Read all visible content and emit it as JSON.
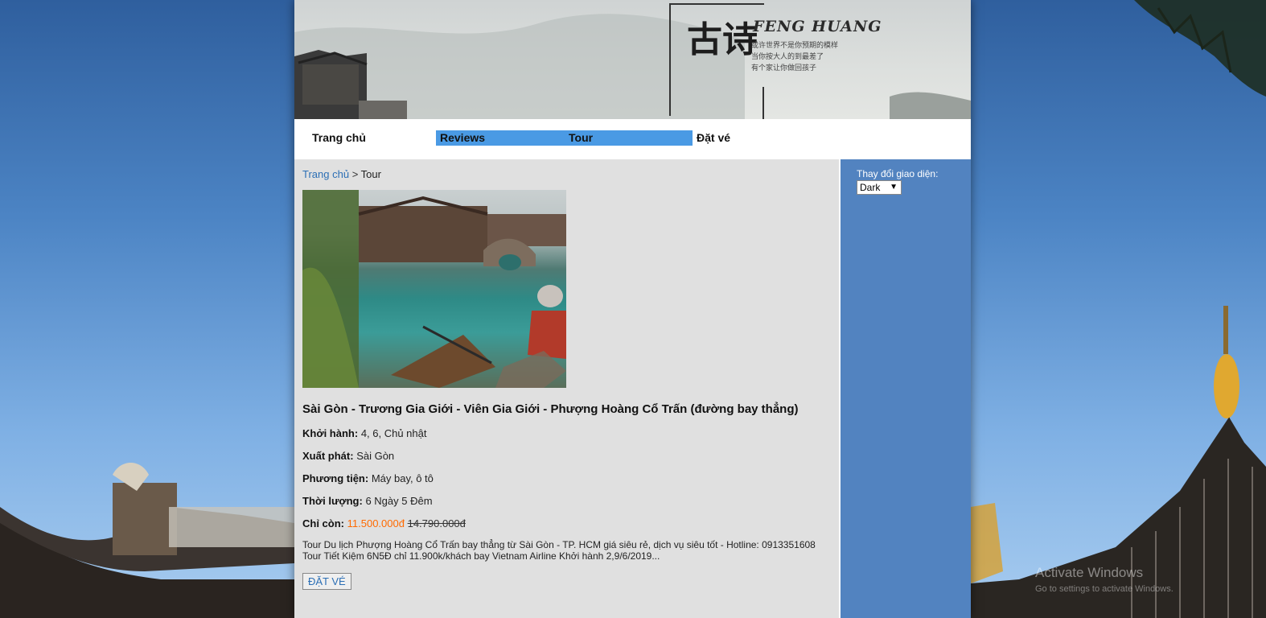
{
  "nav": {
    "home": "Trang chủ",
    "reviews": "Reviews",
    "tour": "Tour",
    "book": "Đặt vé"
  },
  "banner": {
    "title": "FENG HUANG",
    "cn_line1": "或许世界不是你预期的模样",
    "cn_line2": "当你按大人的到最差了",
    "cn_line3": "有个家让你做回孩子",
    "cn_big": "古诗"
  },
  "breadcrumb": {
    "home": "Trang chủ",
    "separator": ">",
    "current": "Tour"
  },
  "tour": {
    "title": "Sài Gòn - Trương Gia Giới - Viên Gia Giới - Phượng Hoàng Cổ Trấn (đường bay thẳng)",
    "depart_days_label": "Khởi hành:",
    "depart_days": "4, 6, Chủ nhật",
    "origin_label": "Xuất phát:",
    "origin": "Sài Gòn",
    "transport_label": "Phương tiện:",
    "transport": "Máy bay, ô tô",
    "duration_label": "Thời lượng:",
    "duration": "6 Ngày 5 Đêm",
    "price_label": "Chỉ còn:",
    "price_now": "11.500.000đ",
    "price_old": "14.790.000đ",
    "description": "Tour Du lịch Phượng Hoàng Cổ Trấn bay thẳng từ Sài Gòn - TP. HCM giá siêu rẻ, dịch vụ siêu tốt - Hotline: 0913351608 Tour Tiết Kiệm 6N5Đ chỉ 11.900k/khách bay Vietnam Airline Khởi hành 2,9/6/2019...",
    "book_button": "ĐẶT VÉ"
  },
  "sidebar": {
    "theme_label": "Thay đổi giao diện:",
    "theme_value": "Dark"
  },
  "os": {
    "watermark": "Activate Windows",
    "watermark_sub": "Go to settings to activate Windows."
  },
  "colors": {
    "nav_active": "#4a9ae4",
    "sidebar": "#5283c0",
    "price": "#ff6a00",
    "link": "#2c6fb5"
  }
}
